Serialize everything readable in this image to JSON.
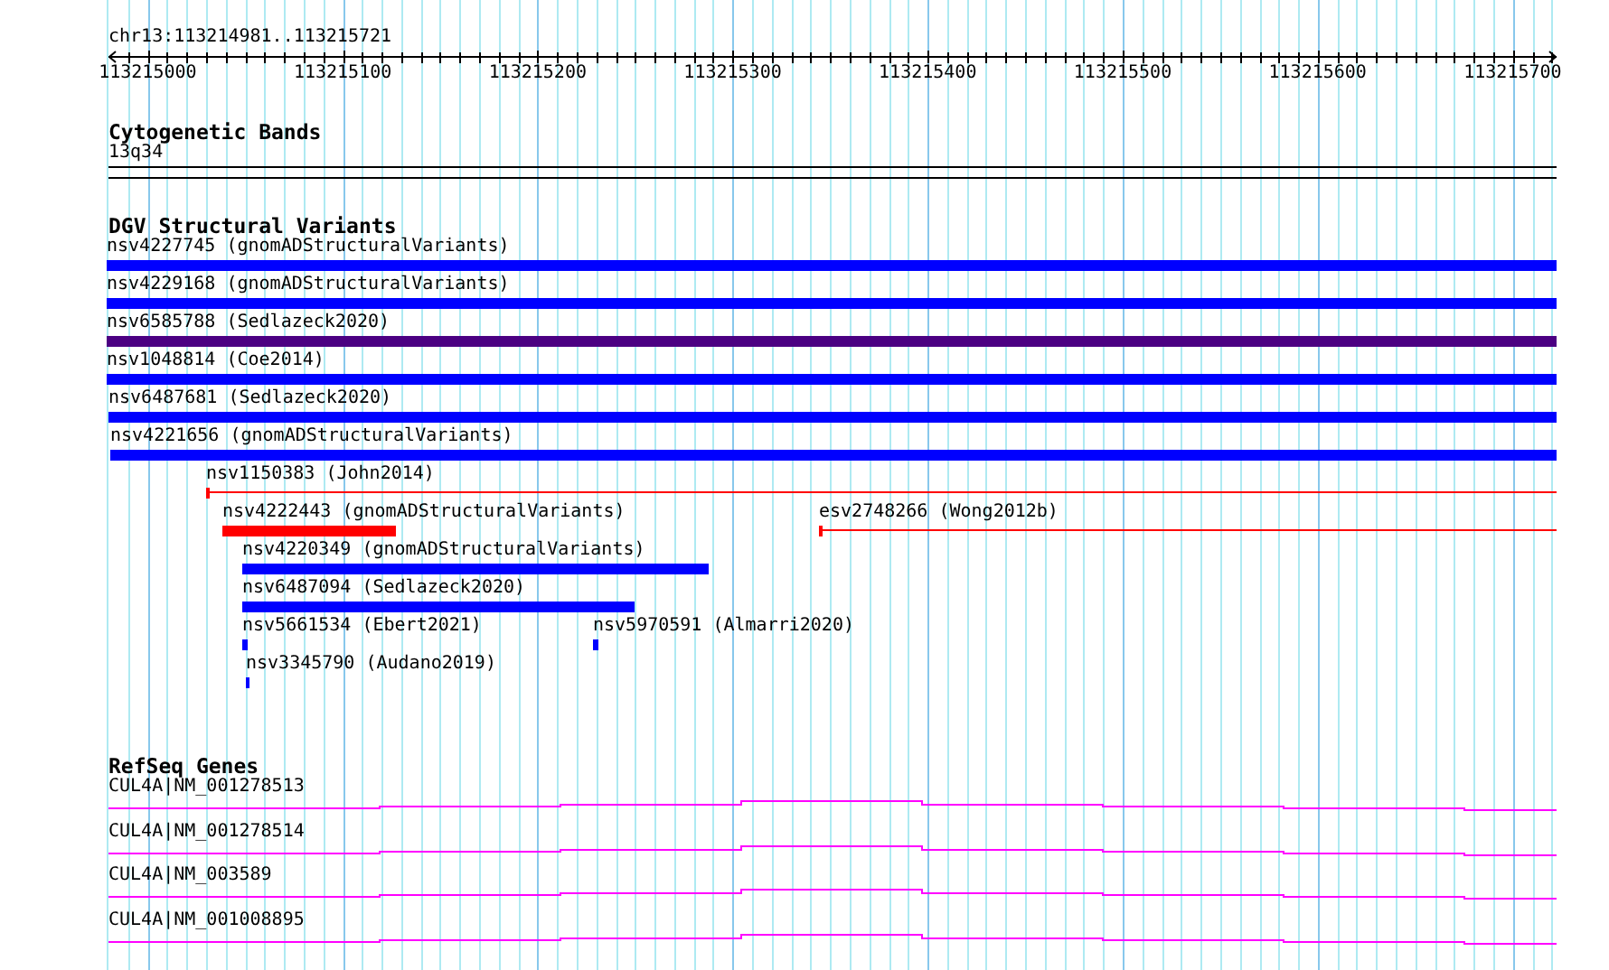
{
  "ruler": {
    "region": "chr13:113214981..113215721",
    "ticks": [
      "113215000",
      "113215100",
      "113215200",
      "113215300",
      "113215400",
      "113215500",
      "113215600",
      "113215700"
    ]
  },
  "tracks": [
    {
      "kind": "bands",
      "title": "Cytogenetic Bands",
      "features": [
        {
          "label": "13q34"
        }
      ]
    },
    {
      "kind": "variants",
      "title": "DGV Structural Variants",
      "rows": [
        {
          "features": [
            {
              "label": "nsv4227745 (gnomADStructuralVariants)",
              "kind": "bar",
              "color": "#0000ff"
            }
          ]
        },
        {
          "features": [
            {
              "label": "nsv4229168 (gnomADStructuralVariants)",
              "kind": "bar",
              "color": "#0000ff"
            }
          ]
        },
        {
          "features": [
            {
              "label": "nsv6585788 (Sedlazeck2020)",
              "kind": "bar",
              "color": "#4b0082"
            }
          ]
        },
        {
          "features": [
            {
              "label": "nsv1048814 (Coe2014)",
              "kind": "bar",
              "color": "#0000ff"
            }
          ]
        },
        {
          "features": [
            {
              "label": "nsv6487681 (Sedlazeck2020)",
              "kind": "bar",
              "color": "#0000ff"
            }
          ]
        },
        {
          "features": [
            {
              "label": "nsv4221656 (gnomADStructuralVariants)",
              "kind": "bar",
              "color": "#0000ff"
            }
          ]
        },
        {
          "features": [
            {
              "label": "nsv1150383 (John2014)",
              "kind": "line",
              "color": "#ff0000"
            }
          ]
        },
        {
          "features": [
            {
              "label": "nsv4222443 (gnomADStructuralVariants)",
              "kind": "bar",
              "color": "#ff0000"
            },
            {
              "label": "esv2748266 (Wong2012b)",
              "kind": "line",
              "color": "#ff0000"
            }
          ]
        },
        {
          "features": [
            {
              "label": "nsv4220349 (gnomADStructuralVariants)",
              "kind": "bar",
              "color": "#0000ff"
            }
          ]
        },
        {
          "features": [
            {
              "label": "nsv6487094 (Sedlazeck2020)",
              "kind": "bar",
              "color": "#0000ff"
            }
          ]
        },
        {
          "features": [
            {
              "label": "nsv5661534 (Ebert2021)",
              "kind": "bar",
              "color": "#0000ff"
            },
            {
              "label": "nsv5970591 (Almarri2020)",
              "kind": "bar",
              "color": "#0000ff"
            }
          ]
        },
        {
          "features": [
            {
              "label": "nsv3345790 (Audano2019)",
              "kind": "bar",
              "color": "#0000ff"
            }
          ]
        }
      ]
    },
    {
      "kind": "genes",
      "title": "RefSeq Genes",
      "features": [
        {
          "label": "CUL4A|NM_001278513"
        },
        {
          "label": "CUL4A|NM_001278514"
        },
        {
          "label": "CUL4A|NM_003589"
        },
        {
          "label": "CUL4A|NM_001008895"
        }
      ]
    }
  ]
}
